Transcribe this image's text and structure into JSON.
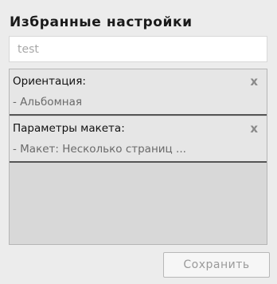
{
  "panel": {
    "title": "Избранные настройки",
    "name_input": {
      "value": "test",
      "placeholder": ""
    }
  },
  "settings_list": {
    "items": [
      {
        "title": "Ориентация:",
        "value": "- Альбомная",
        "remove_glyph": "x"
      },
      {
        "title": "Параметры макета:",
        "value": "- Макет: Несколько страниц ...",
        "remove_glyph": "x"
      }
    ]
  },
  "footer": {
    "save_label": "Сохранить"
  },
  "colors": {
    "background": "#ececec",
    "list_background": "#d8d8d8",
    "item_background": "#e6e6e6",
    "item_separator": "#555555",
    "title_text": "#1a1a1a",
    "muted_text": "#6a6a6a"
  }
}
